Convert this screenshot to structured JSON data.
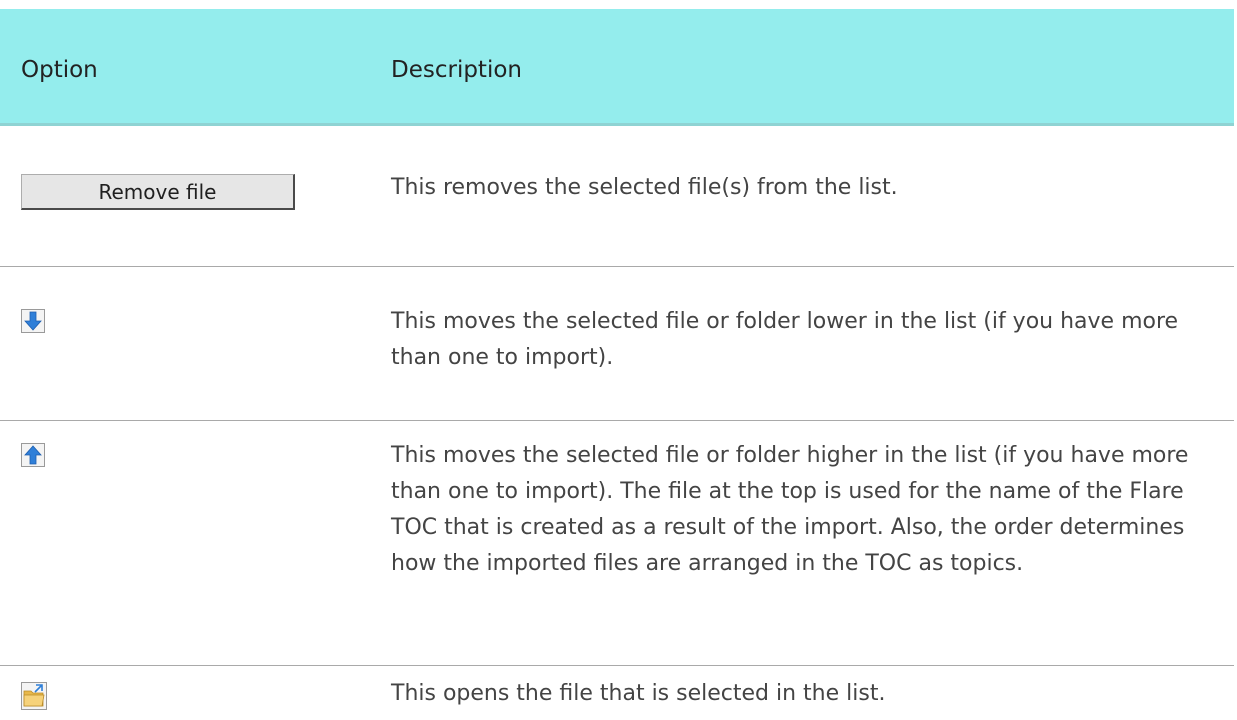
{
  "table": {
    "header": {
      "option": "Option",
      "description": "Description"
    },
    "rows": [
      {
        "option_type": "button",
        "button_label": "Remove file",
        "description": "This removes the selected file(s) from the list."
      },
      {
        "option_type": "icon",
        "icon": "move-down-icon",
        "description": "This moves the selected file or folder lower in the list (if you have more than one to import)."
      },
      {
        "option_type": "icon",
        "icon": "move-up-icon",
        "description": "This moves the selected file or folder higher in the list (if you have more than one to import). The file at the top is used for the name of the Flare TOC that is created as a result of the import. Also, the order determines how the imported files are arranged in the TOC as topics."
      },
      {
        "option_type": "icon",
        "icon": "open-file-icon",
        "description": "This opens the file that is selected in the list."
      }
    ]
  },
  "colors": {
    "header_background": "#94eded",
    "header_border": "#8fd3d3",
    "row_divider": "#a9a9a9",
    "arrow_blue": "#2f7fd8"
  }
}
